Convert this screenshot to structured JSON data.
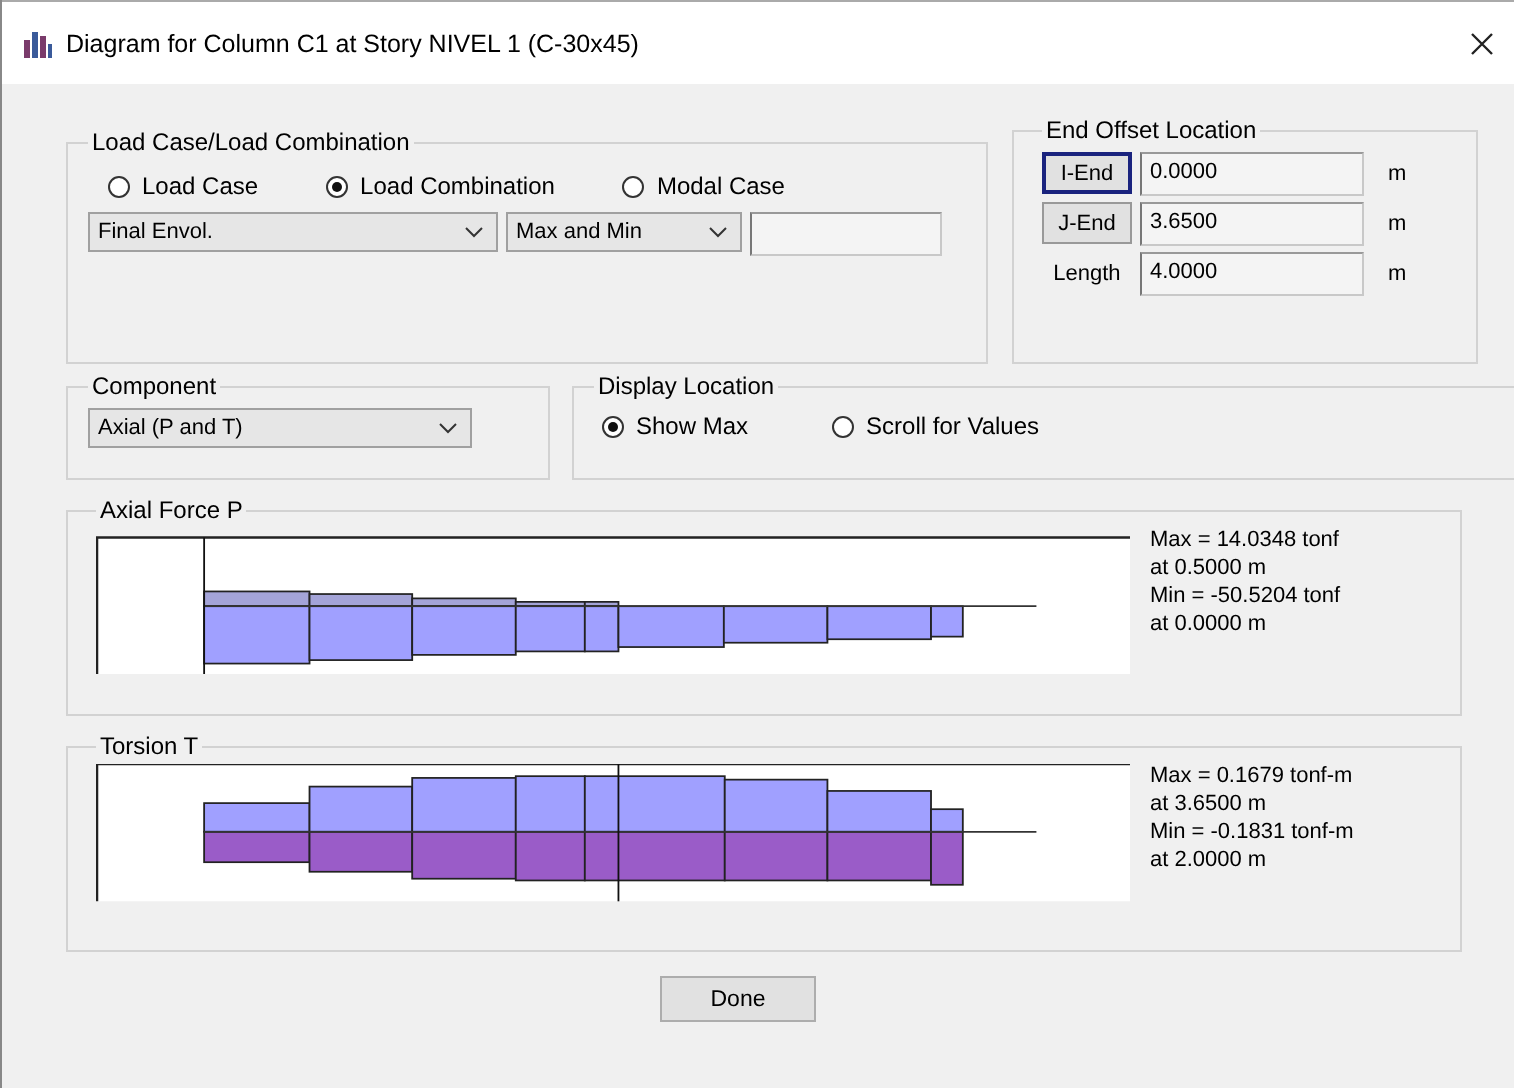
{
  "window": {
    "title": "Diagram for Column C1 at Story NIVEL 1 (C-30x45)"
  },
  "load_case_group": {
    "title": "Load Case/Load Combination",
    "options": [
      {
        "label": "Load Case",
        "selected": false
      },
      {
        "label": "Load Combination",
        "selected": true
      },
      {
        "label": "Modal Case",
        "selected": false
      }
    ],
    "combo": "Final Envol.",
    "mode": "Max and Min"
  },
  "end_offset": {
    "title": "End Offset Location",
    "rows": [
      {
        "kind": "button",
        "label": "I-End",
        "focused": true,
        "value": "0.0000",
        "unit": "m"
      },
      {
        "kind": "button",
        "label": "J-End",
        "focused": false,
        "value": "3.6500",
        "unit": "m"
      },
      {
        "kind": "label",
        "label": "Length",
        "value": "4.0000",
        "unit": "m"
      }
    ]
  },
  "component": {
    "title": "Component",
    "value": "Axial (P and T)"
  },
  "display_location": {
    "title": "Display Location",
    "options": [
      {
        "label": "Show Max",
        "selected": true
      },
      {
        "label": "Scroll for Values",
        "selected": false
      }
    ]
  },
  "diagrams": [
    {
      "kind": "axial",
      "title": "Axial Force P",
      "lines": [
        "Max = 14.0348 tonf",
        "at 0.5000 m",
        "Min = -50.5204 tonf",
        "at 0.0000 m"
      ]
    },
    {
      "kind": "torsion",
      "title": "Torsion T",
      "lines": [
        "Max = 0.1679 tonf-m",
        "at 3.6500 m",
        "Min = -0.1831 tonf-m",
        "at 2.0000 m"
      ]
    }
  ],
  "buttons": [
    "Done"
  ]
}
